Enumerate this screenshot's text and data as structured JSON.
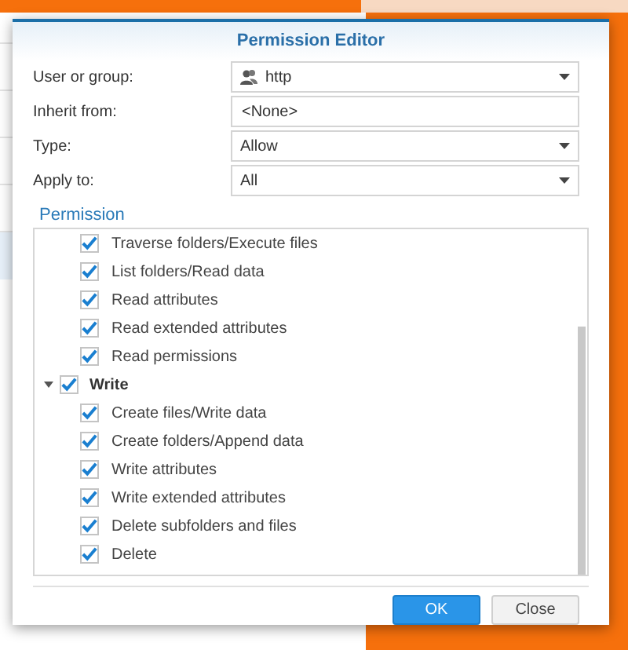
{
  "dialog": {
    "title": "Permission Editor"
  },
  "fields": [
    {
      "label": "User or group:",
      "value": "http",
      "kind": "user-select"
    },
    {
      "label": "Inherit from:",
      "value": "<None>",
      "kind": "text"
    },
    {
      "label": "Type:",
      "value": "Allow",
      "kind": "select"
    },
    {
      "label": "Apply to:",
      "value": "All",
      "kind": "select"
    }
  ],
  "permission_heading": "Permission",
  "permissions": [
    {
      "children": [
        {
          "label": "Traverse folders/Execute files",
          "checked": true
        },
        {
          "label": "List folders/Read data",
          "checked": true
        },
        {
          "label": "Read attributes",
          "checked": true
        },
        {
          "label": "Read extended attributes",
          "checked": true
        },
        {
          "label": "Read permissions",
          "checked": true
        }
      ]
    },
    {
      "label": "Write",
      "checked": true,
      "expanded": true,
      "children": [
        {
          "label": "Create files/Write data",
          "checked": true
        },
        {
          "label": "Create folders/Append data",
          "checked": true
        },
        {
          "label": "Write attributes",
          "checked": true
        },
        {
          "label": "Write extended attributes",
          "checked": true
        },
        {
          "label": "Delete subfolders and files",
          "checked": true
        },
        {
          "label": "Delete",
          "checked": true
        }
      ]
    }
  ],
  "buttons": [
    {
      "label": "OK",
      "kind": "primary"
    },
    {
      "label": "Close",
      "kind": "secondary"
    }
  ]
}
